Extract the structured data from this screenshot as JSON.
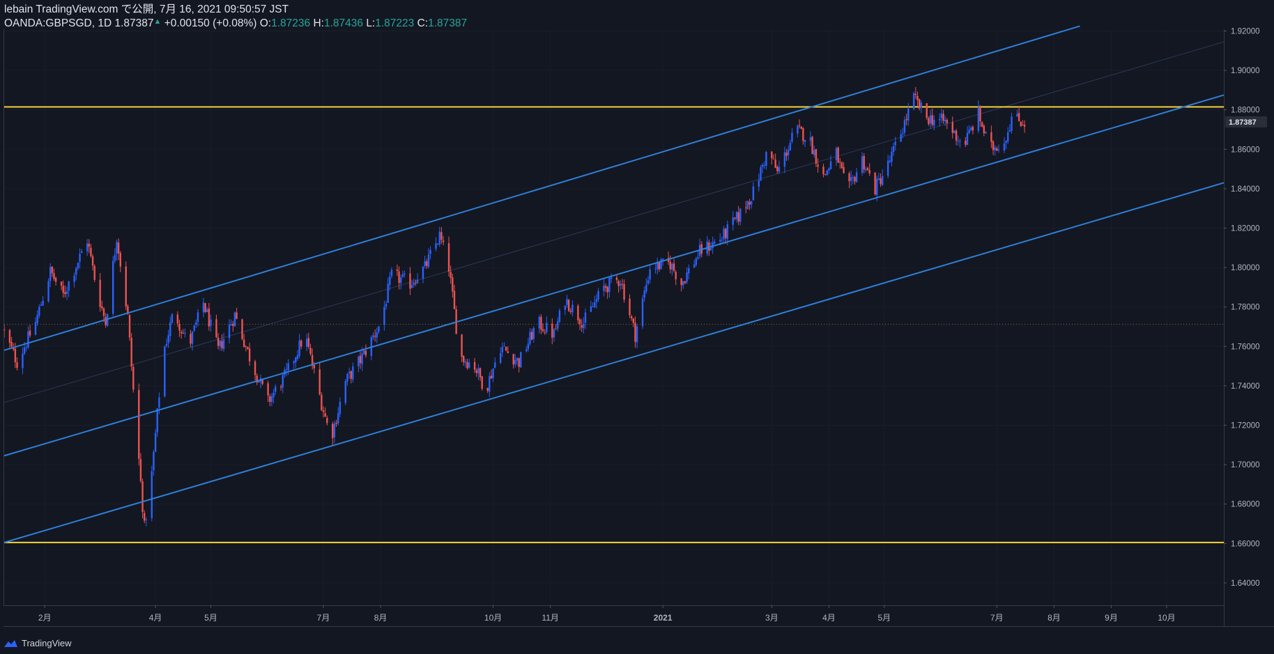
{
  "header": {
    "line1": "lebain TradingView.com で公開, 7月 16, 2021 09:50:57 JST",
    "symbol": "OANDA:GBPSGD, 1D 1.87387",
    "change": "+0.00150 (+0.08%)",
    "o_label": "O:",
    "o_value": "1.87236",
    "h_label": "H:",
    "h_value": "1.87436",
    "l_label": "L:",
    "l_value": "1.87223",
    "c_label": "C:",
    "c_value": "1.87387"
  },
  "footer": {
    "brand": "TradingView"
  },
  "colors": {
    "background": "#131722",
    "up": "#2962ff",
    "down": "#ef5350",
    "horizontal_line": "#f5d33b",
    "channel_line": "#2f7fd8",
    "price_tag_bg": "#2a2e39"
  },
  "chart_data": {
    "type": "candlestick",
    "symbol": "OANDA:GBPSGD",
    "interval": "1D",
    "last_price": 1.87387,
    "last_price_label": "1.87387",
    "ylim": [
      1.63,
      1.92
    ],
    "y_ticks": [
      "1.92000",
      "1.90000",
      "1.88000",
      "1.86000",
      "1.84000",
      "1.82000",
      "1.80000",
      "1.78000",
      "1.76000",
      "1.74000",
      "1.72000",
      "1.70000",
      "1.68000",
      "1.66000",
      "1.64000"
    ],
    "y_tick_values": [
      1.92,
      1.9,
      1.88,
      1.86,
      1.84,
      1.82,
      1.8,
      1.78,
      1.76,
      1.74,
      1.72,
      1.7,
      1.68,
      1.66,
      1.64
    ],
    "x_start": "2020-01-10",
    "x_end": "2021-11-01",
    "x_ticks": [
      {
        "label": "2月",
        "date": "2020-02-01"
      },
      {
        "label": "4月",
        "date": "2020-04-01"
      },
      {
        "label": "5月",
        "date": "2020-05-01"
      },
      {
        "label": "7月",
        "date": "2020-07-01"
      },
      {
        "label": "8月",
        "date": "2020-08-01"
      },
      {
        "label": "10月",
        "date": "2020-10-01"
      },
      {
        "label": "11月",
        "date": "2020-11-01"
      },
      {
        "label": "2021",
        "date": "2021-01-01"
      },
      {
        "label": "3月",
        "date": "2021-03-01"
      },
      {
        "label": "4月",
        "date": "2021-04-01"
      },
      {
        "label": "5月",
        "date": "2021-05-01"
      },
      {
        "label": "7月",
        "date": "2021-07-01"
      },
      {
        "label": "8月",
        "date": "2021-08-01"
      },
      {
        "label": "9月",
        "date": "2021-09-01"
      },
      {
        "label": "10月",
        "date": "2021-10-01"
      }
    ],
    "horizontal_lines": [
      {
        "price": 1.8815,
        "style": "solid"
      },
      {
        "price": 1.6605,
        "style": "solid"
      },
      {
        "price": 1.7712,
        "style": "dotted"
      }
    ],
    "channel_lines": [
      {
        "from": {
          "date": "2020-01-10",
          "price": 1.758
        },
        "to": {
          "date": "2021-08-15",
          "price": 1.9225
        }
      },
      {
        "from": {
          "date": "2020-01-10",
          "price": 1.7045
        },
        "to": {
          "date": "2021-11-01",
          "price": 1.8875
        }
      },
      {
        "from": {
          "date": "2020-01-10",
          "price": 1.6605
        },
        "to": {
          "date": "2021-11-01",
          "price": 1.843
        }
      }
    ],
    "midline": {
      "from": {
        "date": "2020-01-10",
        "price": 1.7315
      },
      "to": {
        "date": "2021-11-01",
        "price": 1.9145
      }
    },
    "price_path": [
      {
        "date": "2020-01-10",
        "price": 1.769
      },
      {
        "date": "2020-01-18",
        "price": 1.752
      },
      {
        "date": "2020-01-28",
        "price": 1.772
      },
      {
        "date": "2020-02-05",
        "price": 1.798
      },
      {
        "date": "2020-02-12",
        "price": 1.786
      },
      {
        "date": "2020-02-25",
        "price": 1.814
      },
      {
        "date": "2020-03-01",
        "price": 1.79
      },
      {
        "date": "2020-03-06",
        "price": 1.772
      },
      {
        "date": "2020-03-12",
        "price": 1.816
      },
      {
        "date": "2020-03-18",
        "price": 1.775
      },
      {
        "date": "2020-03-22",
        "price": 1.725
      },
      {
        "date": "2020-03-27",
        "price": 1.668
      },
      {
        "date": "2020-03-31",
        "price": 1.695
      },
      {
        "date": "2020-04-06",
        "price": 1.756
      },
      {
        "date": "2020-04-12",
        "price": 1.778
      },
      {
        "date": "2020-04-20",
        "price": 1.76
      },
      {
        "date": "2020-04-28",
        "price": 1.782
      },
      {
        "date": "2020-05-06",
        "price": 1.758
      },
      {
        "date": "2020-05-15",
        "price": 1.776
      },
      {
        "date": "2020-05-24",
        "price": 1.752
      },
      {
        "date": "2020-06-02",
        "price": 1.732
      },
      {
        "date": "2020-06-12",
        "price": 1.746
      },
      {
        "date": "2020-06-22",
        "price": 1.766
      },
      {
        "date": "2020-06-30",
        "price": 1.735
      },
      {
        "date": "2020-07-06",
        "price": 1.713
      },
      {
        "date": "2020-07-14",
        "price": 1.742
      },
      {
        "date": "2020-07-24",
        "price": 1.756
      },
      {
        "date": "2020-08-02",
        "price": 1.772
      },
      {
        "date": "2020-08-08",
        "price": 1.796
      },
      {
        "date": "2020-08-18",
        "price": 1.792
      },
      {
        "date": "2020-08-26",
        "price": 1.8
      },
      {
        "date": "2020-09-03",
        "price": 1.816
      },
      {
        "date": "2020-09-08",
        "price": 1.8
      },
      {
        "date": "2020-09-14",
        "price": 1.755
      },
      {
        "date": "2020-09-22",
        "price": 1.75
      },
      {
        "date": "2020-09-28",
        "price": 1.738
      },
      {
        "date": "2020-10-06",
        "price": 1.76
      },
      {
        "date": "2020-10-16",
        "price": 1.752
      },
      {
        "date": "2020-10-26",
        "price": 1.772
      },
      {
        "date": "2020-11-04",
        "price": 1.766
      },
      {
        "date": "2020-11-10",
        "price": 1.784
      },
      {
        "date": "2020-11-20",
        "price": 1.772
      },
      {
        "date": "2020-12-01",
        "price": 1.79
      },
      {
        "date": "2020-12-10",
        "price": 1.794
      },
      {
        "date": "2020-12-18",
        "price": 1.766
      },
      {
        "date": "2020-12-26",
        "price": 1.8
      },
      {
        "date": "2021-01-06",
        "price": 1.802
      },
      {
        "date": "2021-01-12",
        "price": 1.792
      },
      {
        "date": "2021-01-22",
        "price": 1.808
      },
      {
        "date": "2021-02-03",
        "price": 1.815
      },
      {
        "date": "2021-02-12",
        "price": 1.826
      },
      {
        "date": "2021-02-20",
        "price": 1.838
      },
      {
        "date": "2021-02-28",
        "price": 1.86
      },
      {
        "date": "2021-03-05",
        "price": 1.848
      },
      {
        "date": "2021-03-15",
        "price": 1.87
      },
      {
        "date": "2021-03-22",
        "price": 1.866
      },
      {
        "date": "2021-03-30",
        "price": 1.846
      },
      {
        "date": "2021-04-06",
        "price": 1.858
      },
      {
        "date": "2021-04-12",
        "price": 1.838
      },
      {
        "date": "2021-04-20",
        "price": 1.855
      },
      {
        "date": "2021-04-27",
        "price": 1.84
      },
      {
        "date": "2021-05-04",
        "price": 1.852
      },
      {
        "date": "2021-05-10",
        "price": 1.866
      },
      {
        "date": "2021-05-18",
        "price": 1.886
      },
      {
        "date": "2021-05-25",
        "price": 1.876
      },
      {
        "date": "2021-06-04",
        "price": 1.874
      },
      {
        "date": "2021-06-14",
        "price": 1.862
      },
      {
        "date": "2021-06-22",
        "price": 1.878
      },
      {
        "date": "2021-06-28",
        "price": 1.86
      },
      {
        "date": "2021-07-06",
        "price": 1.864
      },
      {
        "date": "2021-07-10",
        "price": 1.876
      },
      {
        "date": "2021-07-16",
        "price": 1.8739
      }
    ]
  }
}
